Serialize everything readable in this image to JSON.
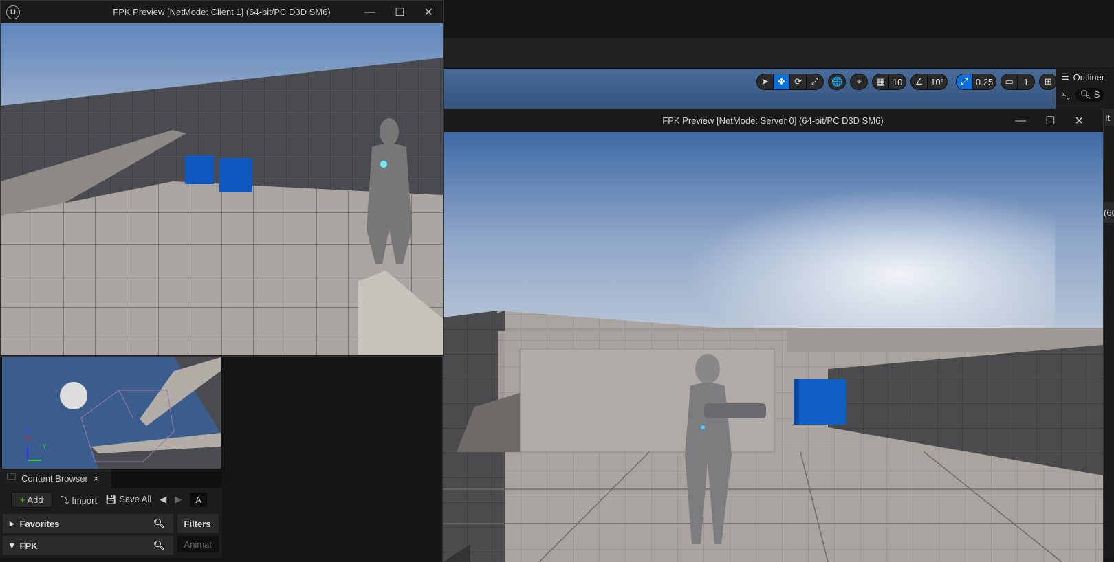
{
  "client_window": {
    "title": "FPK Preview [NetMode: Client 1]  (64-bit/PC D3D SM6)",
    "logo": "unreal-logo"
  },
  "server_window": {
    "title": "FPK Preview [NetMode: Server 0]  (64-bit/PC D3D SM6)"
  },
  "window_controls": {
    "minimize": "—",
    "maximize": "☐",
    "close": "✕"
  },
  "viewport_toolbar": {
    "select": "➤",
    "translate": "✥",
    "rotate": "⟳",
    "scale": "⤢",
    "world": "🌐",
    "surface_snap": "⌖",
    "grid": "▦",
    "grid_value": "10",
    "angle": "∠",
    "angle_value": "10°",
    "scale_snap": "⤢",
    "scale_value": "0.25",
    "camera": "▭",
    "camera_speed": "1",
    "layout": "⊞",
    "accent": "#0e6fd6"
  },
  "outliner": {
    "title": "Outliner",
    "search_placeholder": "S",
    "col_header": "It",
    "row_text": "(66"
  },
  "axis": {
    "z": "Z",
    "x": "X",
    "y": "Y"
  },
  "content_browser": {
    "tab": "Content Browser",
    "close": "×",
    "add": "Add",
    "import": "Import",
    "save_all": "Save All",
    "path_text": "A",
    "favorites": "Favorites",
    "fpk": "FPK",
    "filters": "Filters",
    "filter_search": "Animat"
  }
}
